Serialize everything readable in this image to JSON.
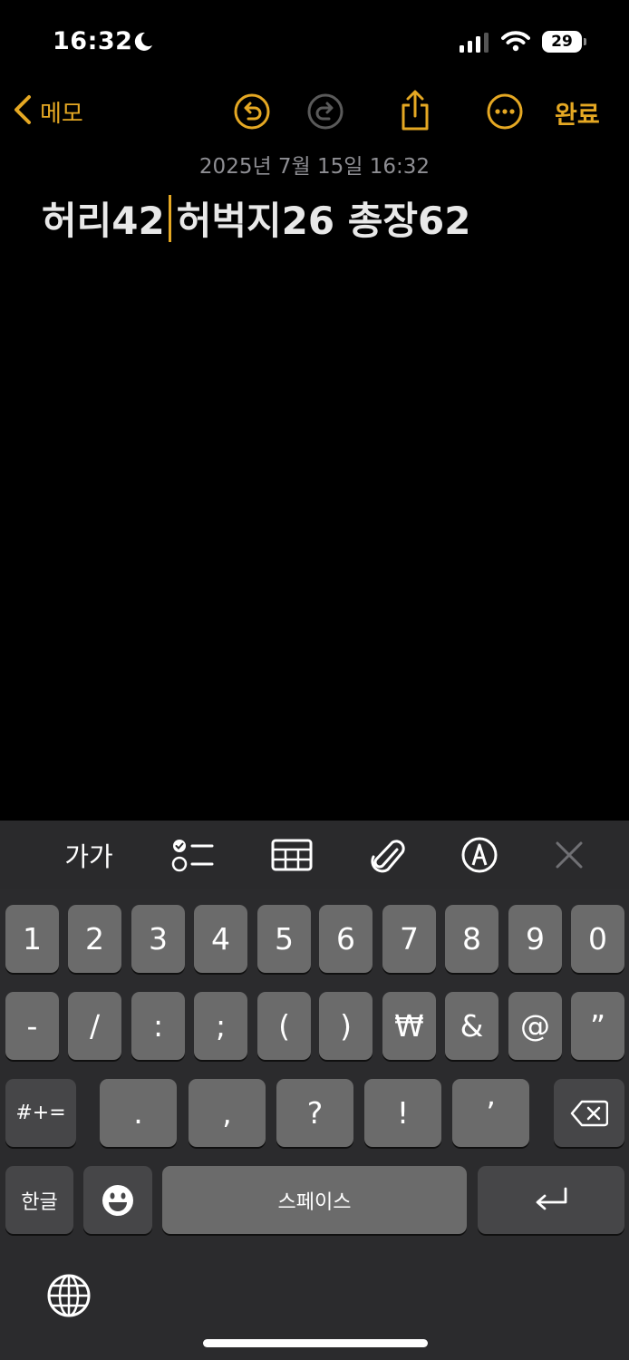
{
  "status_bar": {
    "time": "16:32",
    "battery": "29"
  },
  "nav": {
    "back_label": "메모",
    "done_label": "완료"
  },
  "note": {
    "date": "2025년 7월 15일 16:32",
    "text_before_caret": "허리42",
    "text_after_caret": "허벅지26 총장62"
  },
  "toolbar": {
    "format_label": "가가"
  },
  "keyboard": {
    "row1": [
      "1",
      "2",
      "3",
      "4",
      "5",
      "6",
      "7",
      "8",
      "9",
      "0"
    ],
    "row2": [
      "-",
      "/",
      ":",
      ";",
      "(",
      ")",
      "₩",
      "&",
      "@",
      "”"
    ],
    "row3": [
      ".",
      ",",
      "?",
      "!",
      "’"
    ],
    "symbols_label": "#+=",
    "lang_label": "한글",
    "space_label": "스페이스"
  },
  "colors": {
    "accent": "#e5a823",
    "background": "#000000",
    "key": "#6b6b6b",
    "key_dark": "#464648"
  }
}
